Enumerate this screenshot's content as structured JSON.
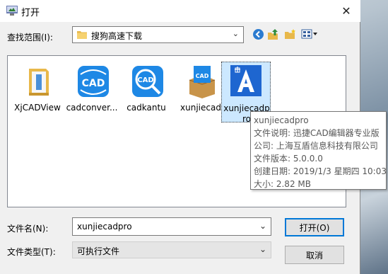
{
  "window": {
    "title": "打开",
    "close_glyph": "✕"
  },
  "look_in": {
    "label": "查找范围(I):",
    "value": "搜狗高速下载"
  },
  "toolbar": [
    "back-icon",
    "up-folder-icon",
    "new-folder-icon",
    "view-menu-icon"
  ],
  "files": [
    {
      "name": "XjCADView",
      "icon": "folder-file-icon"
    },
    {
      "name": "cadconver...",
      "icon": "cad-converter-icon"
    },
    {
      "name": "cadkantu",
      "icon": "cad-magnifier-icon"
    },
    {
      "name": "xunjiecad",
      "icon": "cad-box-icon"
    },
    {
      "name": "xunjiecadpro",
      "icon": "cad-pro-icon",
      "selected": true
    }
  ],
  "tooltip": {
    "name": "xunjiecadpro",
    "description": "文件说明: 迅捷CAD编辑器专业版",
    "company": "公司: 上海互盾信息科技有限公司",
    "version": "文件版本: 5.0.0.0",
    "created": "创建日期: 2019/1/3 星期四 10:03",
    "size": "大小: 2.82 MB"
  },
  "file_name": {
    "label": "文件名(N):",
    "value": "xunjiecadpro"
  },
  "file_type": {
    "label": "文件类型(T):",
    "value": "可执行文件"
  },
  "buttons": {
    "open": "打开(O)",
    "cancel": "取消"
  },
  "colors": {
    "accent": "#0078d7",
    "cad_blue": "#1e88e5",
    "selection": "#cce8ff"
  }
}
